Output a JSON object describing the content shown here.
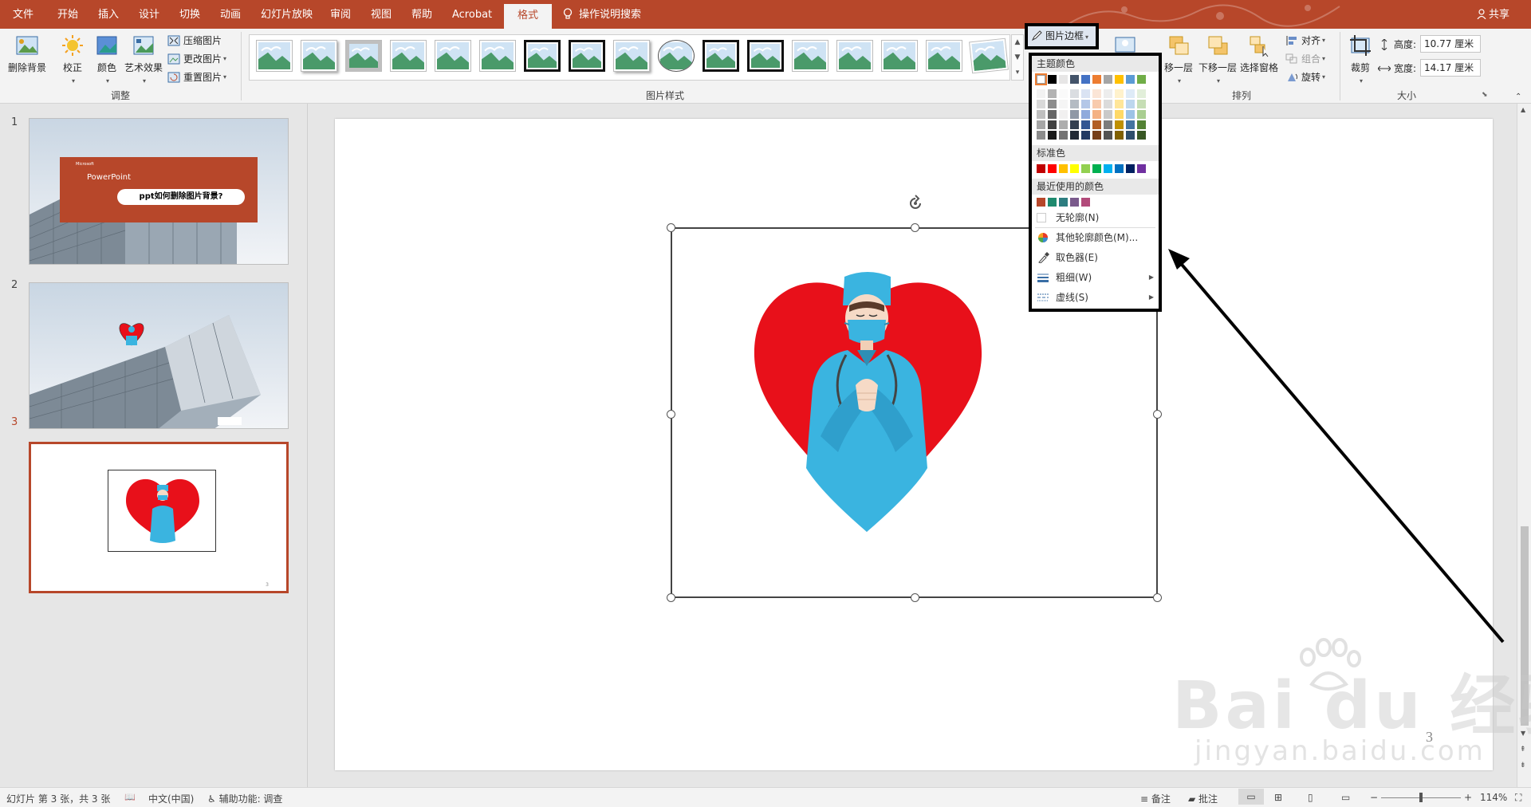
{
  "tabs": [
    "文件",
    "开始",
    "插入",
    "设计",
    "切换",
    "动画",
    "幻灯片放映",
    "审阅",
    "视图",
    "帮助",
    "Acrobat",
    "格式"
  ],
  "active_tab": "格式",
  "tell_me": "操作说明搜索",
  "share": "共享",
  "ribbon": {
    "remove_bg": "删除背景",
    "corrections": "校正",
    "color": "颜色",
    "artistic": "艺术效果",
    "compress": "压缩图片",
    "change": "更改图片",
    "reset": "重置图片",
    "adjust_group": "调整",
    "styles_group": "图片样式",
    "picture_border": "图片边框",
    "backward": "移一层",
    "send_backward": "下移一层",
    "selection_pane": "选择窗格",
    "align": "对齐",
    "group": "组合",
    "rotate": "旋转",
    "arrange_group": "排列",
    "crop": "裁剪",
    "height_label": "高度:",
    "height_value": "10.77 厘米",
    "width_label": "宽度:",
    "width_value": "14.17 厘米",
    "size_group": "大小"
  },
  "dropdown": {
    "theme_colors": "主题颜色",
    "standard_colors": "标准色",
    "recent_colors": "最近使用的颜色",
    "no_outline": "无轮廓(N)",
    "more_colors": "其他轮廓颜色(M)...",
    "eyedropper": "取色器(E)",
    "weight": "粗细(W)",
    "dashes": "虚线(S)",
    "theme_top": [
      "#ffffff",
      "#000000",
      "#e7e6e6",
      "#44546a",
      "#4472c4",
      "#ed7d31",
      "#a5a5a5",
      "#ffc000",
      "#5b9bd5",
      "#70ad47"
    ],
    "standard": [
      "#c00000",
      "#ff0000",
      "#ffc000",
      "#ffff00",
      "#92d050",
      "#00b050",
      "#00b0f0",
      "#0070c0",
      "#002060",
      "#7030a0"
    ],
    "recent": [
      "#b7472a",
      "#1e8a6e",
      "#2d7d80",
      "#7a5a8c",
      "#b24a7a"
    ]
  },
  "slides": {
    "numbers": [
      "1",
      "2",
      "3"
    ],
    "slide1_title": "PowerPoint",
    "slide1_subtitle": "ppt如何删除图片背景?",
    "slide1_brand": "Microsoft",
    "slide_page_number": "3"
  },
  "status": {
    "slide_info": "幻灯片 第 3 张，共 3 张",
    "language": "中文(中国)",
    "accessibility": "辅助功能: 调查",
    "notes": "备注",
    "comments": "批注",
    "zoom": "114%"
  },
  "watermark": {
    "text": "Bai du 经验",
    "url": "jingyan.baidu.com"
  }
}
